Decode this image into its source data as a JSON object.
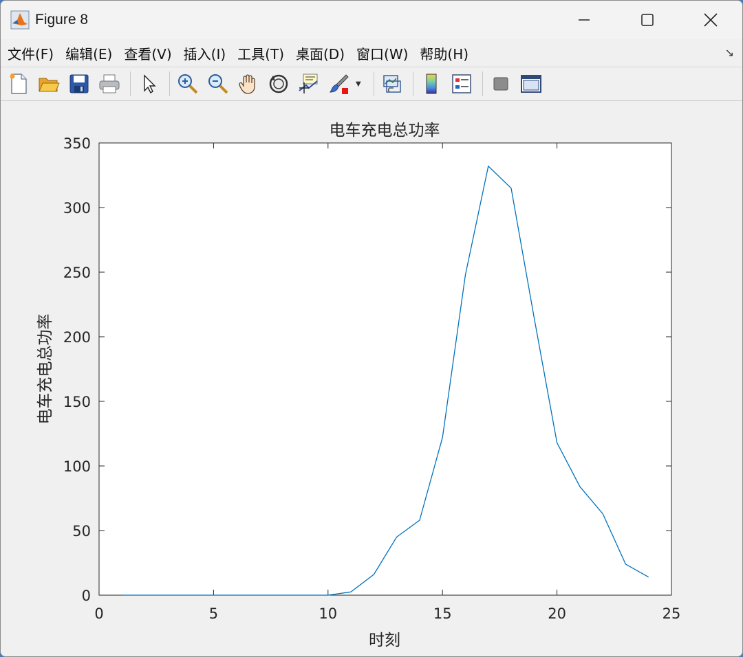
{
  "window": {
    "title": "Figure 8",
    "controls": [
      "minimize",
      "maximize",
      "close"
    ]
  },
  "menu": {
    "items": [
      {
        "id": "file",
        "label": "文件(F)"
      },
      {
        "id": "edit",
        "label": "编辑(E)"
      },
      {
        "id": "view",
        "label": "查看(V)"
      },
      {
        "id": "insert",
        "label": "插入(I)"
      },
      {
        "id": "tools",
        "label": "工具(T)"
      },
      {
        "id": "desktop",
        "label": "桌面(D)"
      },
      {
        "id": "window",
        "label": "窗口(W)"
      },
      {
        "id": "help",
        "label": "帮助(H)"
      }
    ],
    "overflow_icon": "↘"
  },
  "toolbar": {
    "icons": [
      "new-figure-icon",
      "open-file-icon",
      "save-icon",
      "print-icon",
      "select-arrow-icon",
      "zoom-in-icon",
      "zoom-out-icon",
      "pan-hand-icon",
      "rotate-3d-icon",
      "data-cursor-icon",
      "brush-icon",
      "link-plot-icon",
      "colorbar-icon",
      "legend-icon",
      "hide-plot-tools-icon",
      "show-plot-tools-icon"
    ]
  },
  "colors": {
    "line": "#0072BD",
    "axes_bg": "#ffffff",
    "figure_bg": "#f0f0f0"
  },
  "chart_data": {
    "type": "line",
    "title": "电车充电总功率",
    "xlabel": "时刻",
    "ylabel": "电车充电总功率",
    "xlim": [
      0,
      25
    ],
    "ylim": [
      0,
      350
    ],
    "xticks": [
      0,
      5,
      10,
      15,
      20,
      25
    ],
    "yticks": [
      0,
      50,
      100,
      150,
      200,
      250,
      300,
      350
    ],
    "grid": false,
    "series": [
      {
        "x": [
          1,
          2,
          3,
          4,
          5,
          6,
          7,
          8,
          9,
          10,
          11,
          12,
          13,
          14,
          15,
          16,
          17,
          18,
          19,
          20,
          21,
          22,
          23,
          24
        ],
        "y": [
          0,
          0,
          0,
          0,
          0,
          0,
          0,
          0,
          0,
          0,
          2.5,
          16,
          45,
          58,
          122,
          248,
          332,
          315,
          215,
          118,
          84,
          63,
          24,
          14
        ]
      }
    ]
  }
}
